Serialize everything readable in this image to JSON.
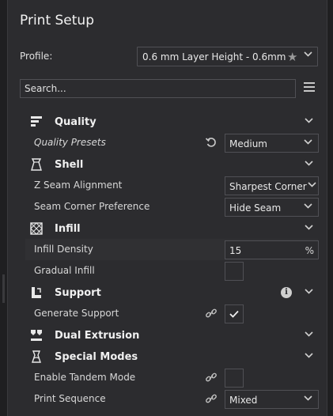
{
  "header": {
    "title": "Print Setup"
  },
  "profile": {
    "label": "Profile:",
    "value": "0.6 mm Layer Height - 0.6mm"
  },
  "search": {
    "placeholder": "Search..."
  },
  "categories": {
    "quality": {
      "label": "Quality"
    },
    "shell": {
      "label": "Shell"
    },
    "infill": {
      "label": "Infill"
    },
    "support": {
      "label": "Support"
    },
    "dual_extrusion": {
      "label": "Dual Extrusion"
    },
    "special_modes": {
      "label": "Special Modes"
    }
  },
  "settings": {
    "quality_presets": {
      "label": "Quality Presets",
      "value": "Medium"
    },
    "z_seam_alignment": {
      "label": "Z Seam Alignment",
      "value": "Sharpest Corner"
    },
    "seam_corner_preference": {
      "label": "Seam Corner Preference",
      "value": "Hide Seam"
    },
    "infill_density": {
      "label": "Infill Density",
      "value": "15",
      "unit": "%"
    },
    "gradual_infill": {
      "label": "Gradual Infill",
      "checked": false
    },
    "generate_support": {
      "label": "Generate Support",
      "checked": true
    },
    "enable_tandem_mode": {
      "label": "Enable Tandem Mode",
      "checked": false
    },
    "print_sequence": {
      "label": "Print Sequence",
      "value": "Mixed"
    }
  },
  "icons": {
    "star": "star-icon",
    "chevron": "chevron-down-icon",
    "menu": "hamburger-menu-icon",
    "link": "link-icon",
    "reset": "reset-icon",
    "info": "info-icon",
    "check": "checkmark-icon"
  },
  "colors": {
    "panel": "#2c2c2f",
    "border": "#505055",
    "text": "#e8e8e8"
  }
}
